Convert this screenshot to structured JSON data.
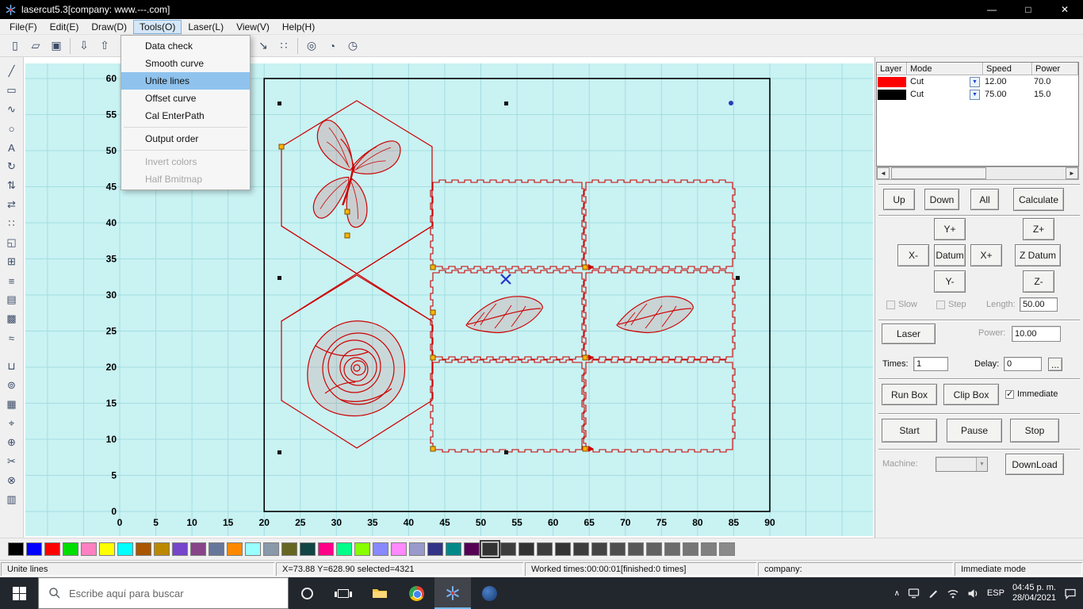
{
  "titlebar": {
    "title": "lasercut5.3[company: www.---.com]",
    "controls": [
      "—",
      "□",
      "✕"
    ]
  },
  "menubar": {
    "items": [
      "File(F)",
      "Edit(E)",
      "Draw(D)",
      "Tools(O)",
      "Laser(L)",
      "View(V)",
      "Help(H)"
    ],
    "active_index": 3
  },
  "tools_menu": [
    {
      "label": "Data check"
    },
    {
      "label": "Smooth curve"
    },
    {
      "label": "Unite lines",
      "highlight": true
    },
    {
      "label": "Offset curve"
    },
    {
      "label": "Cal EnterPath"
    },
    {
      "sep": true
    },
    {
      "label": "Output order"
    },
    {
      "sep": true
    },
    {
      "label": "Invert colors",
      "disabled": true
    },
    {
      "label": "Half Bmitmap",
      "disabled": true
    }
  ],
  "toolbar": [
    {
      "name": "new-file",
      "glyph": "▯"
    },
    {
      "name": "open-file",
      "glyph": "▱"
    },
    {
      "name": "save-file",
      "glyph": "▣"
    },
    {
      "sep": true
    },
    {
      "name": "import-file",
      "glyph": "⇩"
    },
    {
      "name": "output-file",
      "glyph": "⇧"
    },
    {
      "name": "node-edit",
      "glyph": "✎"
    },
    {
      "name": "measure",
      "glyph": "∠"
    },
    {
      "sep": true
    },
    {
      "name": "select-box",
      "glyph": "⊡"
    },
    {
      "name": "zoom-in",
      "glyph": "⊞"
    },
    {
      "name": "zoom-out",
      "glyph": "⊟"
    },
    {
      "sep": true
    },
    {
      "name": "set-origin",
      "glyph": "→"
    },
    {
      "name": "cut-direction",
      "glyph": "↘"
    },
    {
      "name": "array-copy",
      "glyph": "∷"
    },
    {
      "sep": true
    },
    {
      "name": "data-check",
      "glyph": "◎"
    },
    {
      "name": "simulate",
      "glyph": "◔"
    },
    {
      "name": "time-estimate",
      "glyph": "◷"
    }
  ],
  "left_toolbar": [
    {
      "name": "draw-line",
      "glyph": "╱"
    },
    {
      "name": "draw-rectangle",
      "glyph": "▭"
    },
    {
      "name": "draw-curve",
      "glyph": "∿"
    },
    {
      "name": "draw-ellipse",
      "glyph": "○"
    },
    {
      "name": "draw-text",
      "glyph": "A"
    },
    {
      "name": "rotate",
      "glyph": "↻"
    },
    {
      "name": "mirror-vertical",
      "glyph": "⇅"
    },
    {
      "name": "mirror-horizontal",
      "glyph": "⇄"
    },
    {
      "name": "dot-mark",
      "glyph": "∷"
    },
    {
      "name": "scale",
      "glyph": "◱"
    },
    {
      "name": "array",
      "glyph": "⊞"
    },
    {
      "name": "align",
      "glyph": "≡"
    },
    {
      "name": "hatch",
      "glyph": "▤"
    },
    {
      "name": "fill",
      "glyph": "▩"
    },
    {
      "name": "smooth",
      "glyph": "≈"
    },
    {
      "sep": true
    },
    {
      "name": "weld",
      "glyph": "⊔"
    },
    {
      "name": "offset",
      "glyph": "⊚"
    },
    {
      "name": "grid-array",
      "glyph": "▦"
    },
    {
      "name": "center-point",
      "glyph": "⌖"
    },
    {
      "name": "group",
      "glyph": "⊕"
    },
    {
      "name": "cut-trim",
      "glyph": "✂"
    },
    {
      "name": "ungroup",
      "glyph": "⊗"
    },
    {
      "name": "layers",
      "glyph": "▥"
    }
  ],
  "canvas": {
    "bg": "#c9f2f3",
    "grid_color": "#a4dde0",
    "x_ticks": [
      0,
      5,
      10,
      15,
      20,
      25,
      30,
      35,
      40,
      45,
      50,
      55,
      60,
      65,
      70,
      75,
      80,
      85,
      90
    ],
    "y_ticks": [
      60,
      55,
      50,
      45,
      40,
      35,
      30,
      25,
      20,
      15,
      10,
      5,
      0
    ]
  },
  "layer_panel": {
    "headers": [
      "Layer",
      "Mode",
      "Speed",
      "Power"
    ],
    "rows": [
      {
        "color": "#ff0000",
        "mode": "Cut",
        "speed": "12.00",
        "power": "70.0"
      },
      {
        "color": "#000000",
        "mode": "Cut",
        "speed": "75.00",
        "power": "15.0"
      }
    ],
    "buttons": {
      "up": "Up",
      "down": "Down",
      "all": "All",
      "calculate": "Calculate"
    }
  },
  "jog": {
    "y_plus": "Y+",
    "z_plus": "Z+",
    "x_minus": "X-",
    "datum": "Datum",
    "x_plus": "X+",
    "z_datum": "Z Datum",
    "y_minus": "Y-",
    "z_minus": "Z-",
    "slow": "Slow",
    "step": "Step",
    "length_label": "Length:",
    "length_value": "50.00"
  },
  "laser": {
    "laser": "Laser",
    "power_label": "Power:",
    "power_value": "10.00",
    "times_label": "Times:",
    "times_value": "1",
    "delay_label": "Delay:",
    "delay_value": "0",
    "more": "...",
    "run_box": "Run Box",
    "clip_box": "Clip Box",
    "immediate": "Immediate",
    "start": "Start",
    "pause": "Pause",
    "stop": "Stop",
    "machine_label": "Machine:",
    "download": "DownLoad"
  },
  "glyphs": {
    "left": "◄",
    "right": "►",
    "down": "▼"
  },
  "palette": {
    "selected_index": 26,
    "colors": [
      "#000000",
      "#0000ff",
      "#ff0000",
      "#00dd00",
      "#ff80c0",
      "#ffff00",
      "#00ffff",
      "#aa5500",
      "#bb8800",
      "#7744cc",
      "#884488",
      "#667799",
      "#ff8800",
      "#99ffff",
      "#8899aa",
      "#666622",
      "#114444",
      "#ff0088",
      "#00ff88",
      "#88ff00",
      "#8888ff",
      "#ff88ff",
      "#9999cc",
      "#333388",
      "#008888",
      "#550055",
      "#333333",
      "#3d3d3d",
      "#333333",
      "#3d3d3d",
      "#333333",
      "#3d3d3d",
      "#444444",
      "#4e4e4e",
      "#585858",
      "#626262",
      "#6c6c6c",
      "#767676",
      "#808080",
      "#8a8a8a"
    ]
  },
  "statusbar": {
    "segments": [
      "Unite lines",
      "X=73.88 Y=628.90 selected=4321",
      "Worked times:00:00:01[finished:0 times]",
      "company:",
      "Immediate mode"
    ]
  },
  "taskbar": {
    "search_placeholder": "Escribe aquí para buscar",
    "lang": "ESP",
    "time": "04:45 p. m.",
    "date": "28/04/2021"
  }
}
